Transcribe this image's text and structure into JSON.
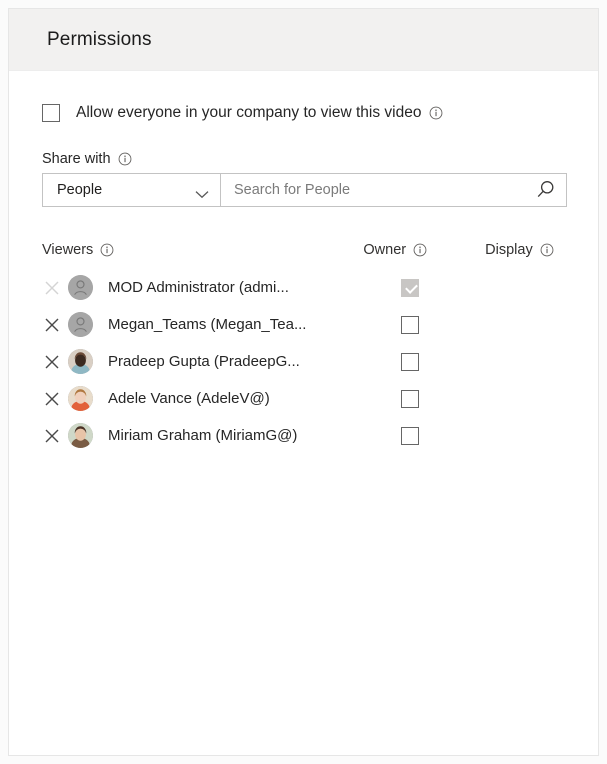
{
  "panel": {
    "title": "Permissions"
  },
  "allow_everyone": {
    "label": "Allow everyone in your company to view this video",
    "checked": false,
    "info_icon": "info-icon"
  },
  "share_with": {
    "label": "Share with",
    "info_icon": "info-icon",
    "scope_value": "People",
    "scope_options": [
      "People"
    ],
    "chevron_icon": "chevron-down-icon",
    "search_placeholder": "Search for People",
    "search_value": "",
    "search_icon": "search-icon"
  },
  "table": {
    "columns": [
      {
        "key": "viewers",
        "label": "Viewers",
        "info_icon": "info-icon"
      },
      {
        "key": "owner",
        "label": "Owner",
        "info_icon": "info-icon"
      },
      {
        "key": "display",
        "label": "Display",
        "info_icon": "info-icon"
      }
    ],
    "rows": [
      {
        "name": "MOD Administrator (admi...",
        "avatar_type": "placeholder",
        "owner_checked": true,
        "owner_disabled": true,
        "remove_disabled": true,
        "remove_icon": "close-icon"
      },
      {
        "name": "Megan_Teams (Megan_Tea...",
        "avatar_type": "placeholder",
        "owner_checked": false,
        "owner_disabled": false,
        "remove_disabled": false,
        "remove_icon": "close-icon"
      },
      {
        "name": "Pradeep Gupta (PradeepG...",
        "avatar_type": "photo",
        "avatar_colors": [
          "#d9cfc4",
          "#6b4a36",
          "#3c2a20",
          "#8fb8c4"
        ],
        "owner_checked": false,
        "owner_disabled": false,
        "remove_disabled": false,
        "remove_icon": "close-icon"
      },
      {
        "name": "Adele Vance (AdeleV@)",
        "avatar_type": "photo",
        "avatar_colors": [
          "#e8dccb",
          "#b07840",
          "#f0d0bc",
          "#e2613a"
        ],
        "owner_checked": false,
        "owner_disabled": false,
        "remove_disabled": false,
        "remove_icon": "close-icon"
      },
      {
        "name": "Miriam Graham (MiriamG@)",
        "avatar_type": "photo",
        "avatar_colors": [
          "#cfd8c8",
          "#4a3226",
          "#e8c4a8",
          "#7a5c44"
        ],
        "owner_checked": false,
        "owner_disabled": false,
        "remove_disabled": false,
        "remove_icon": "close-icon"
      }
    ]
  },
  "colors": {
    "header_bg": "#f2f1f0",
    "panel_bg": "#ffffff",
    "page_bg": "#fbfbfb",
    "text": "#262626",
    "border": "#c3c3c3",
    "checkbox_disabled": "#c8c6c4",
    "avatar_placeholder": "#a6a6a6"
  }
}
